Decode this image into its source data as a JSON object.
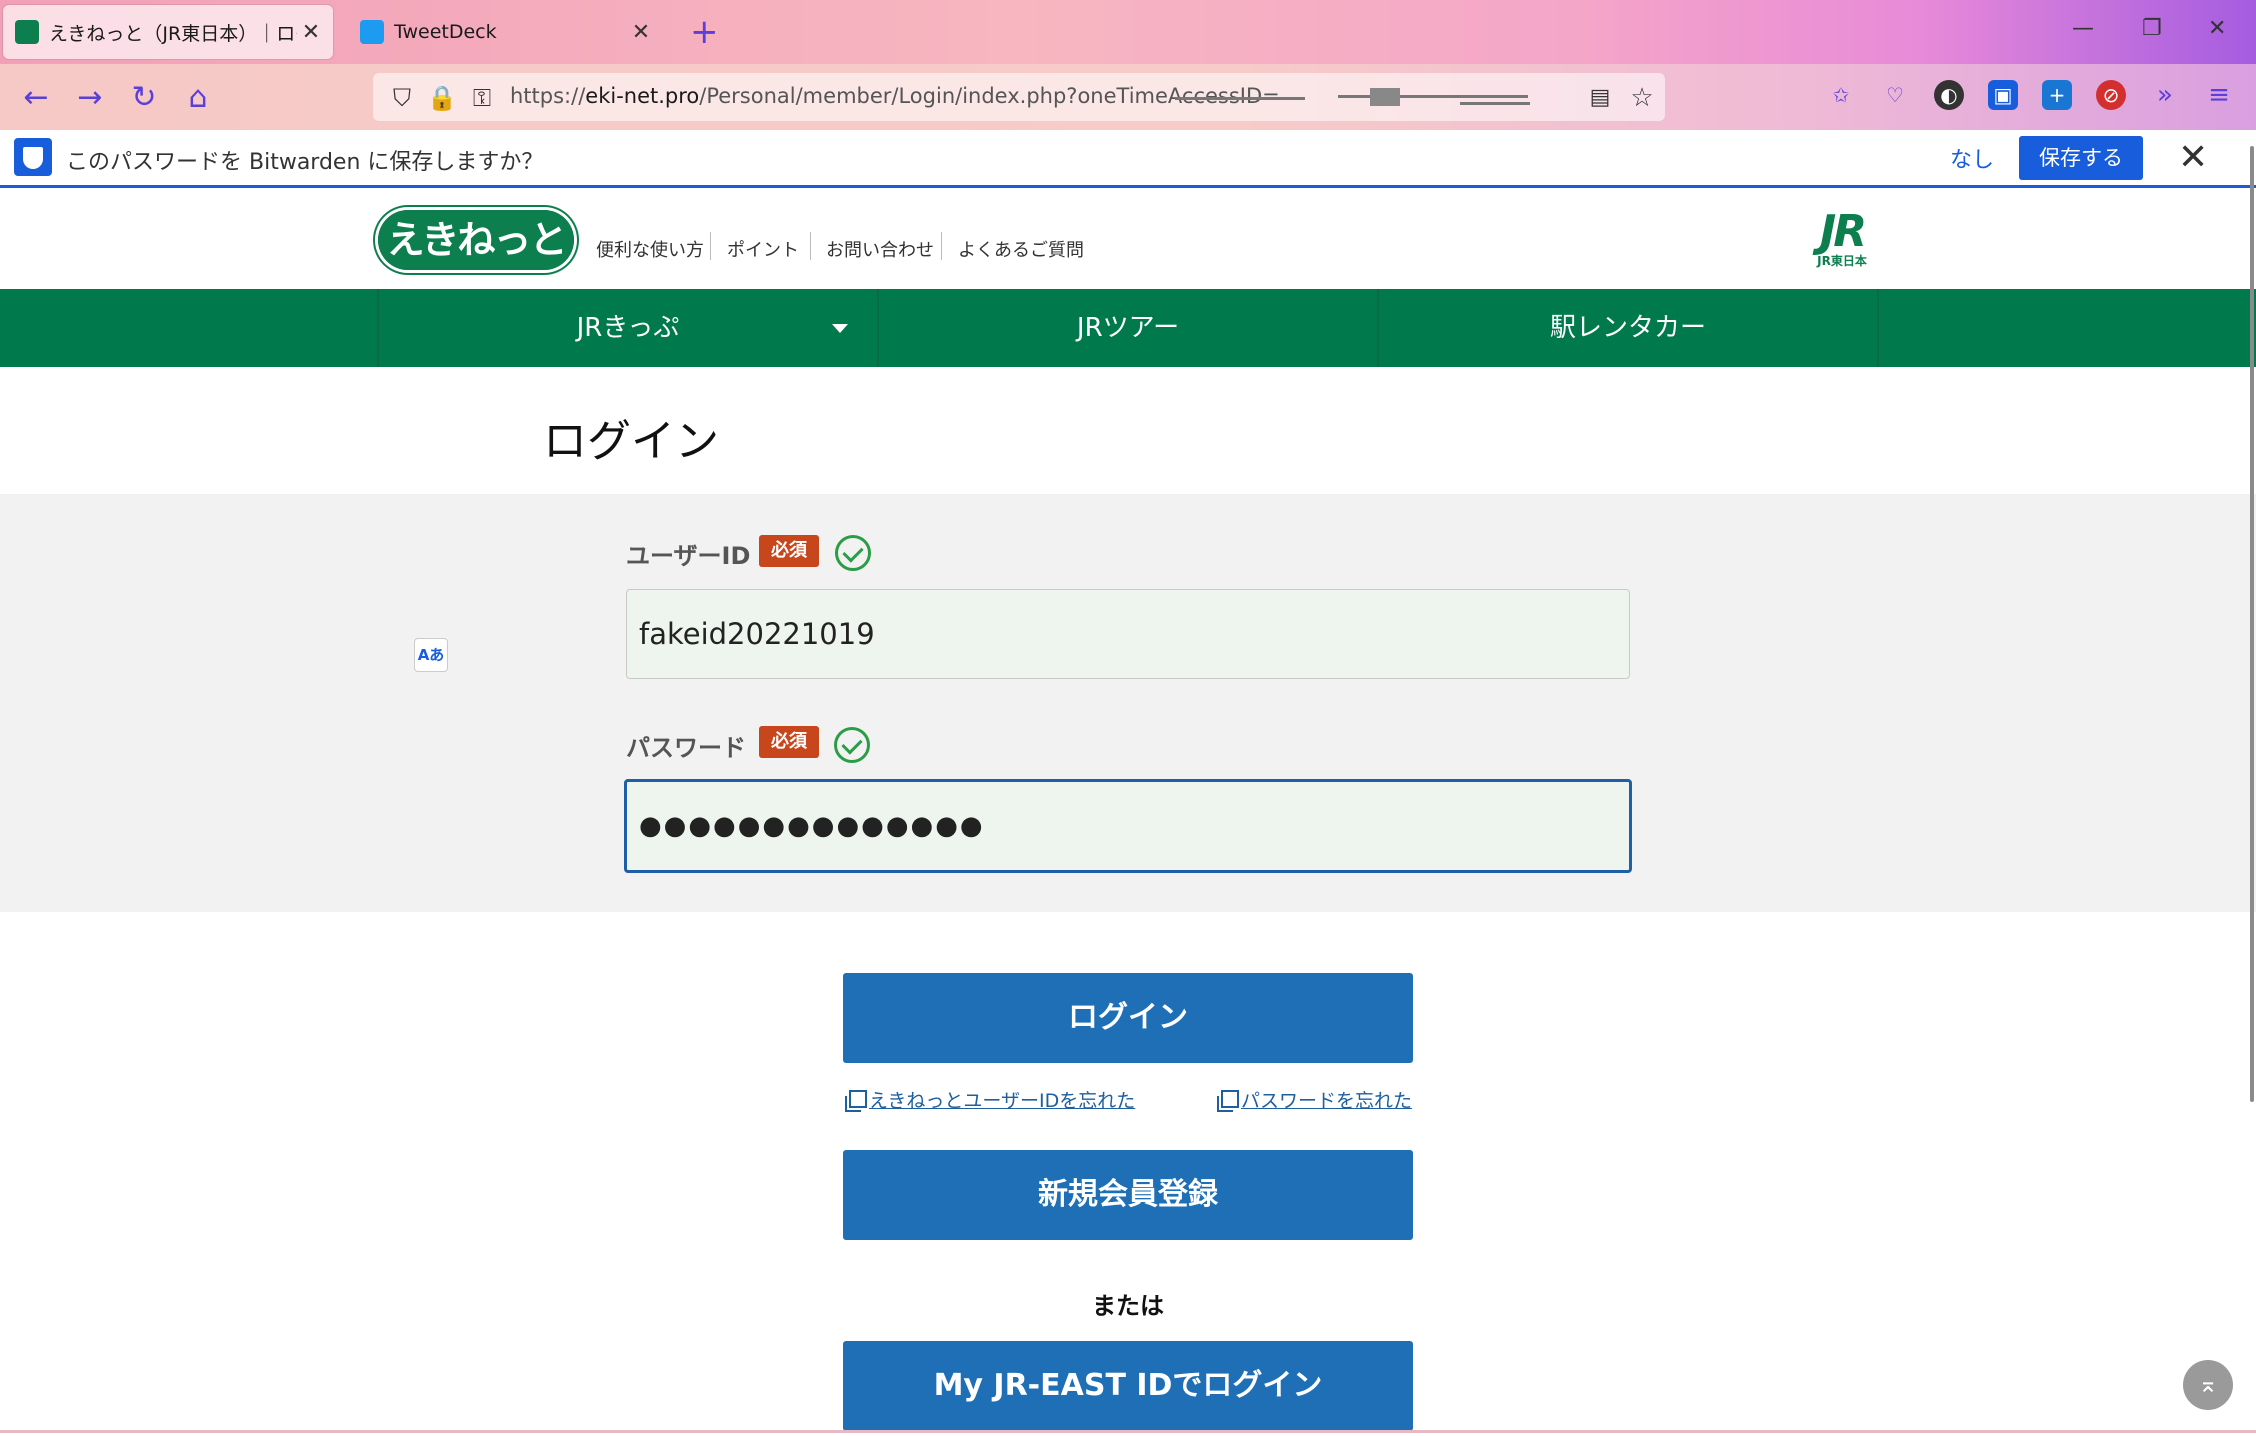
{
  "browser": {
    "tabs": [
      {
        "title": "えきねっと（JR東日本）｜ログ",
        "active": true
      },
      {
        "title": "TweetDeck",
        "active": false
      }
    ],
    "url_prefix": "https://",
    "url_domain": "eki-net.pro",
    "url_path": "/Personal/member/Login/index.php?oneTimeAccessID="
  },
  "bitwarden": {
    "prompt": "このパスワードを Bitwarden に保存しますか？",
    "never_label": "なし",
    "save_label": "保存する"
  },
  "header": {
    "logo_text": "えきねっと",
    "links": [
      "便利な使い方",
      "ポイント",
      "お問い合わせ",
      "よくあるご質問"
    ],
    "jr_logo": "JR",
    "jr_sub": "JR東日本"
  },
  "global_nav": [
    "JRきっぷ",
    "JRツアー",
    "駅レンタカー"
  ],
  "login": {
    "title": "ログイン",
    "user_id_label": "ユーザーID",
    "required_badge": "必須",
    "user_id_value": "fakeid20221019",
    "password_label": "パスワード",
    "password_value": "●●●●●●●●●●●●●●",
    "login_button": "ログイン",
    "forgot_id_link": "えきねっとユーザーIDを忘れた",
    "forgot_password_link": "パスワードを忘れた",
    "register_button": "新規会員登録",
    "or_text": "または",
    "jr_east_button": "My JR-EAST IDでログイン"
  },
  "colors": {
    "brand_green": "#007a4d",
    "button_blue": "#1e6fb5",
    "required_orange": "#c7461b",
    "bitwarden_blue": "#175ddc"
  }
}
